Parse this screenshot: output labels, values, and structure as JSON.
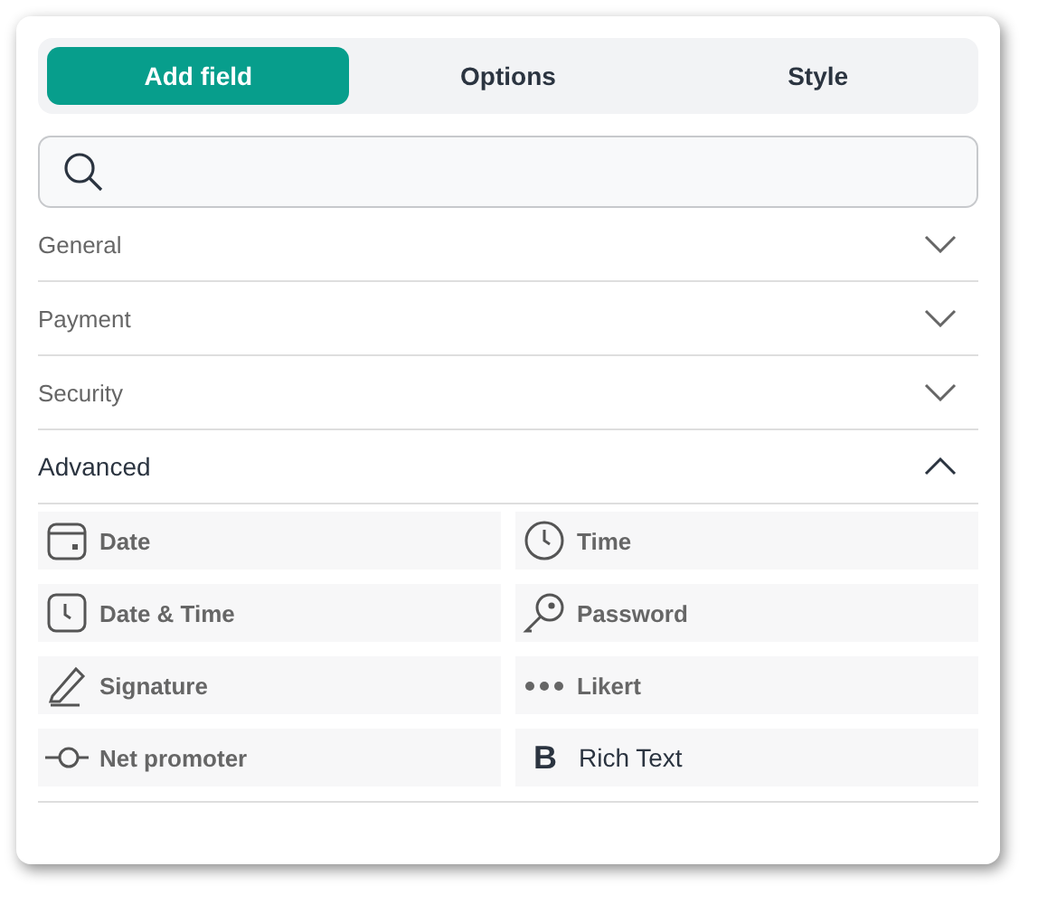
{
  "tabs": [
    {
      "label": "Add field",
      "selected": true
    },
    {
      "label": "Options",
      "selected": false
    },
    {
      "label": "Style",
      "selected": false
    }
  ],
  "sections": [
    {
      "title": "General",
      "expanded": false,
      "blurred": true
    },
    {
      "title": "Payment",
      "expanded": false,
      "blurred": true
    },
    {
      "title": "Security",
      "expanded": false,
      "blurred": true
    },
    {
      "title": "Advanced",
      "expanded": true,
      "blurred": false,
      "fields": [
        {
          "label": "Date",
          "kind": "date",
          "blurred": true
        },
        {
          "label": "Time",
          "kind": "time",
          "blurred": true
        },
        {
          "label": "Date & Time",
          "kind": "datetime",
          "blurred": true
        },
        {
          "label": "Password",
          "kind": "password",
          "blurred": true
        },
        {
          "label": "Signature",
          "kind": "signature",
          "blurred": true
        },
        {
          "label": "Likert",
          "kind": "likert",
          "blurred": true
        },
        {
          "label": "Net promoter",
          "kind": "nps",
          "blurred": true
        },
        {
          "label": "Rich Text",
          "kind": "richtext",
          "glyph": "B",
          "blurred": false
        }
      ]
    }
  ]
}
